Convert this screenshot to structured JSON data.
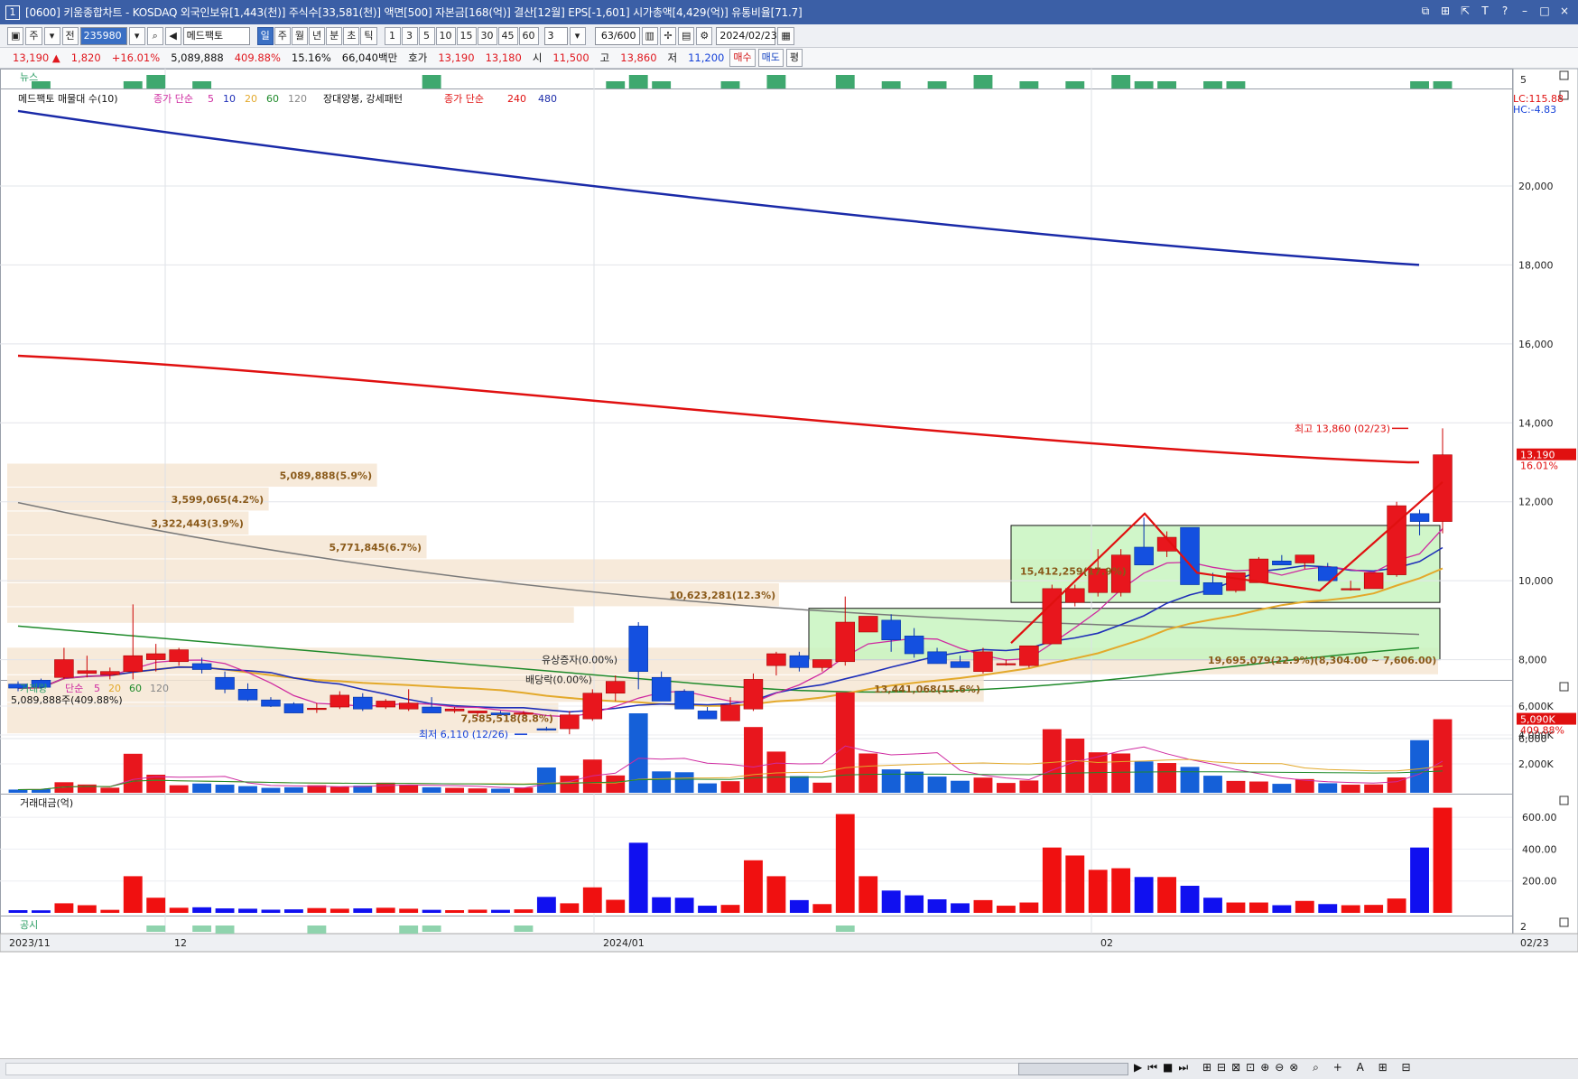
{
  "titlebar": {
    "num": "1",
    "text": "[0600] 키움종합차트 - KOSDAQ 외국인보유[1,443(천)] 주식수[33,581(천)] 액면[500] 자본금[168(억)] 결산[12월] EPS[-1,601] 시가총액[4,429(억)] 유통비율[71.7]"
  },
  "toolbar1": {
    "period_jong": "주",
    "prev": "전",
    "code": "235980",
    "name": "메드팩토",
    "periods": [
      "일",
      "주",
      "월",
      "년",
      "분",
      "초",
      "틱"
    ],
    "selected_period": "일",
    "minutes": [
      "1",
      "3",
      "5",
      "10",
      "15",
      "30",
      "45",
      "60"
    ],
    "interval": "3",
    "count": "63/600",
    "date": "2024/02/23"
  },
  "toolbar2": {
    "price": "13,190",
    "change": "1,820",
    "change_pct": "+16.01%",
    "volume": "5,089,888",
    "volume_ratio": "409.88%",
    "turnover": "15.16%",
    "amount": "66,040백만",
    "hoga_label": "호가",
    "hoga1": "13,190",
    "hoga2": "13,180",
    "open_label": "시",
    "open": "11,500",
    "high_label": "고",
    "high": "13,860",
    "low_label": "저",
    "low": "11,200",
    "buy": "매수",
    "sell": "매도",
    "pyeong": "평"
  },
  "news_panel": {
    "label": "뉴스",
    "scale": "5"
  },
  "price_legend": {
    "vp": "메드팩토 매물대 수(10)",
    "ma_label": "종가 단순",
    "ma": [
      "5",
      "10",
      "20",
      "60",
      "120"
    ],
    "pattern": "장대양봉, 강세패턴",
    "ma2_label": "종가 단순",
    "ma2": [
      "240",
      "480"
    ],
    "lc": "LC:115.88",
    "hc": "HC:-4.83"
  },
  "price_axis": [
    "20,000",
    "18,000",
    "16,000",
    "14,000",
    "12,000",
    "10,000",
    "8,000",
    "6,000"
  ],
  "current_tag": {
    "price": "13,190",
    "pct": "16.01%"
  },
  "annotations": {
    "high": "최고 13,860 (02/23)",
    "low": "최저 6,110 (12/26)",
    "rights": "유상증자(0.00%)",
    "dividend": "배당락(0.00%)",
    "vp_range": "19,695,079(22.9%)(8,304.00 ~ 7,606.00)"
  },
  "volume_profile": [
    {
      "label": "5,089,888(5.9%)",
      "price_hi": 12966,
      "price_lo": 12360,
      "vol": 5089888
    },
    {
      "label": "3,599,065(4.2%)",
      "price_hi": 12360,
      "price_lo": 11754,
      "vol": 3599065
    },
    {
      "label": "3,322,443(3.9%)",
      "price_hi": 11754,
      "price_lo": 11148,
      "vol": 3322443
    },
    {
      "label": "5,771,845(6.7%)",
      "price_hi": 11148,
      "price_lo": 10542,
      "vol": 5771845
    },
    {
      "label": "15,412,259(17.9%)",
      "price_hi": 10542,
      "price_lo": 9936,
      "vol": 15412259
    },
    {
      "label": "10,623,281(12.3%)",
      "price_hi": 9936,
      "price_lo": 9330,
      "vol": 10623281
    },
    {
      "label": "",
      "price_hi": 9330,
      "price_lo": 8910,
      "vol": 7800000
    },
    {
      "label": "19,695,079(22.9%)",
      "price_hi": 8304,
      "price_lo": 7606,
      "vol": 19695079
    },
    {
      "label": "13,441,068(15.6%)",
      "price_hi": 7606,
      "price_lo": 6908,
      "vol": 13441068
    },
    {
      "label": "7,585,518(8.8%)",
      "price_hi": 6908,
      "price_lo": 6110,
      "vol": 7585518
    }
  ],
  "volume_panel": {
    "title": "거래량",
    "ma_label": "단순",
    "ma": [
      "5",
      "20",
      "60",
      "120"
    ],
    "current": "5,089,888주(409.88%)",
    "axis": [
      "6,000K",
      "4,000K",
      "2,000K"
    ],
    "tag": "5,090K",
    "tag_pct": "409.88%"
  },
  "amount_panel": {
    "title": "거래대금(억)",
    "axis": [
      "600.00",
      "400.00",
      "200.00"
    ]
  },
  "disclosure_panel": {
    "label": "공시",
    "scale": "2"
  },
  "x_axis": [
    "2023/11",
    "12",
    "2024/01",
    "02",
    "02/23"
  ],
  "chart_data": {
    "type": "candlestick",
    "ylim": [
      5500,
      22000
    ],
    "dates_start": "2023/11",
    "dates_end": "02/23",
    "candles": [
      [
        7380,
        7450,
        7200,
        7280
      ],
      [
        7480,
        7520,
        7250,
        7300
      ],
      [
        7550,
        8300,
        7500,
        8000
      ],
      [
        7650,
        8100,
        7550,
        7720
      ],
      [
        7620,
        7800,
        7500,
        7700
      ],
      [
        7700,
        9400,
        7500,
        8100
      ],
      [
        8000,
        8400,
        7700,
        8150
      ],
      [
        7950,
        8300,
        7850,
        8250
      ],
      [
        7900,
        8050,
        7650,
        7750
      ],
      [
        7550,
        7700,
        7150,
        7250
      ],
      [
        7250,
        7400,
        6950,
        6980
      ],
      [
        6980,
        7050,
        6800,
        6820
      ],
      [
        6880,
        6920,
        6650,
        6650
      ],
      [
        6750,
        6900,
        6650,
        6770
      ],
      [
        6800,
        7200,
        6750,
        7100
      ],
      [
        7050,
        7150,
        6700,
        6750
      ],
      [
        6800,
        7000,
        6750,
        6950
      ],
      [
        6750,
        7250,
        6700,
        6900
      ],
      [
        6800,
        7050,
        6700,
        6650
      ],
      [
        6700,
        6800,
        6650,
        6750
      ],
      [
        6650,
        6700,
        6550,
        6700
      ],
      [
        6650,
        6700,
        6600,
        6600
      ],
      [
        6650,
        6700,
        6650,
        6650
      ],
      [
        6250,
        6300,
        6200,
        6220
      ],
      [
        6250,
        6700,
        6110,
        6600
      ],
      [
        6500,
        7250,
        6450,
        7150
      ],
      [
        7150,
        7600,
        6950,
        7450
      ],
      [
        8850,
        8950,
        7250,
        7700
      ],
      [
        7550,
        7700,
        6950,
        6950
      ],
      [
        7200,
        7250,
        6750,
        6750
      ],
      [
        6700,
        6800,
        6550,
        6500
      ],
      [
        6450,
        7050,
        6450,
        6850
      ],
      [
        6750,
        7650,
        6700,
        7500
      ],
      [
        7850,
        8200,
        7600,
        8150
      ],
      [
        8100,
        8200,
        7700,
        7800
      ],
      [
        7800,
        8000,
        7700,
        8000
      ],
      [
        7950,
        9600,
        7850,
        8950
      ],
      [
        8700,
        9100,
        8750,
        9100
      ],
      [
        9000,
        9150,
        8200,
        8500
      ],
      [
        8600,
        8800,
        8050,
        8150
      ],
      [
        8200,
        8300,
        7900,
        7900
      ],
      [
        7950,
        8100,
        7800,
        7800
      ],
      [
        7700,
        8300,
        7650,
        8200
      ],
      [
        7900,
        8000,
        7850,
        7900
      ],
      [
        7850,
        8350,
        7800,
        8350
      ],
      [
        8400,
        9900,
        8400,
        9800
      ],
      [
        9450,
        9900,
        9350,
        9800
      ],
      [
        9700,
        10800,
        9600,
        10300
      ],
      [
        9700,
        10800,
        9600,
        10650
      ],
      [
        10850,
        11600,
        10850,
        10400
      ],
      [
        10750,
        11250,
        10600,
        11100
      ],
      [
        11350,
        11350,
        9950,
        9900
      ],
      [
        9950,
        10200,
        9650,
        9650
      ],
      [
        9750,
        10200,
        9700,
        10200
      ],
      [
        9950,
        10600,
        9950,
        10550
      ],
      [
        10500,
        10650,
        10450,
        10400
      ],
      [
        10450,
        10600,
        10300,
        10650
      ],
      [
        10350,
        10450,
        10050,
        10000
      ],
      [
        9800,
        10000,
        9750,
        9800
      ],
      [
        9800,
        10200,
        9800,
        10200
      ],
      [
        10150,
        12000,
        10100,
        11900
      ],
      [
        11700,
        11800,
        11150,
        11500
      ],
      [
        11500,
        13860,
        11200,
        13190
      ]
    ],
    "volume_k": [
      220,
      250,
      730,
      570,
      350,
      2700,
      1250,
      520,
      640,
      560,
      460,
      340,
      380,
      520,
      420,
      490,
      700,
      560,
      380,
      340,
      300,
      280,
      360,
      1750,
      1180,
      2300,
      1200,
      5500,
      1480,
      1420,
      650,
      800,
      4550,
      2850,
      1150,
      700,
      6950,
      2720,
      1620,
      1460,
      1120,
      830,
      1050,
      680,
      850,
      4400,
      3750,
      2800,
      2720,
      2170,
      2060,
      1790,
      1180,
      820,
      780,
      620,
      950,
      660,
      560,
      580,
      1060,
      3640,
      5090
    ],
    "amount_100m": [
      17,
      16,
      60,
      48,
      19,
      230,
      95,
      32,
      35,
      28,
      26,
      20,
      22,
      30,
      26,
      28,
      32,
      26,
      19,
      17,
      20,
      19,
      22,
      100,
      60,
      160,
      82,
      440,
      98,
      95,
      45,
      50,
      330,
      230,
      80,
      55,
      620,
      230,
      140,
      110,
      85,
      60,
      80,
      45,
      65,
      410,
      360,
      270,
      280,
      225,
      225,
      170,
      95,
      65,
      65,
      48,
      75,
      55,
      48,
      50,
      90,
      410,
      660
    ],
    "ma240_endpoints": [
      15700,
      13000
    ],
    "ma480_endpoints": [
      21900,
      18000
    ]
  }
}
